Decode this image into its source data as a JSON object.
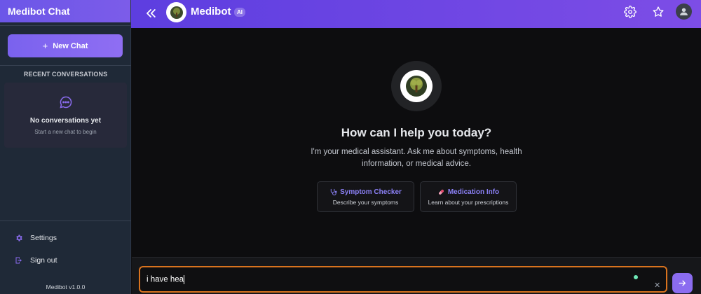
{
  "sidebar": {
    "title": "Medibot Chat",
    "new_chat_label": "New Chat",
    "recent_label": "RECENT CONVERSATIONS",
    "empty_title": "No conversations yet",
    "empty_subtitle": "Start a new chat to begin",
    "settings_label": "Settings",
    "signout_label": "Sign out",
    "version": "Medibot v1.0.0"
  },
  "topbar": {
    "brand": "Medibot",
    "badge": "AI",
    "icons": [
      "collapse-icon",
      "gear-icon",
      "star-icon",
      "user-icon"
    ]
  },
  "main": {
    "headline": "How can I help you today?",
    "subline": "I'm your medical assistant. Ask me about symptoms, health information, or medical advice.",
    "cards": [
      {
        "title": "Symptom Checker",
        "subtitle": "Describe your symptoms",
        "icon": "stethoscope-icon"
      },
      {
        "title": "Medication Info",
        "subtitle": "Learn about your prescriptions",
        "icon": "pill-icon"
      }
    ]
  },
  "composer": {
    "value": "i have hea",
    "clear_symbol": "✕"
  },
  "colors": {
    "accent": "#7c5ce9",
    "input_border": "#d9731e",
    "card_title": "#8b80f6"
  }
}
